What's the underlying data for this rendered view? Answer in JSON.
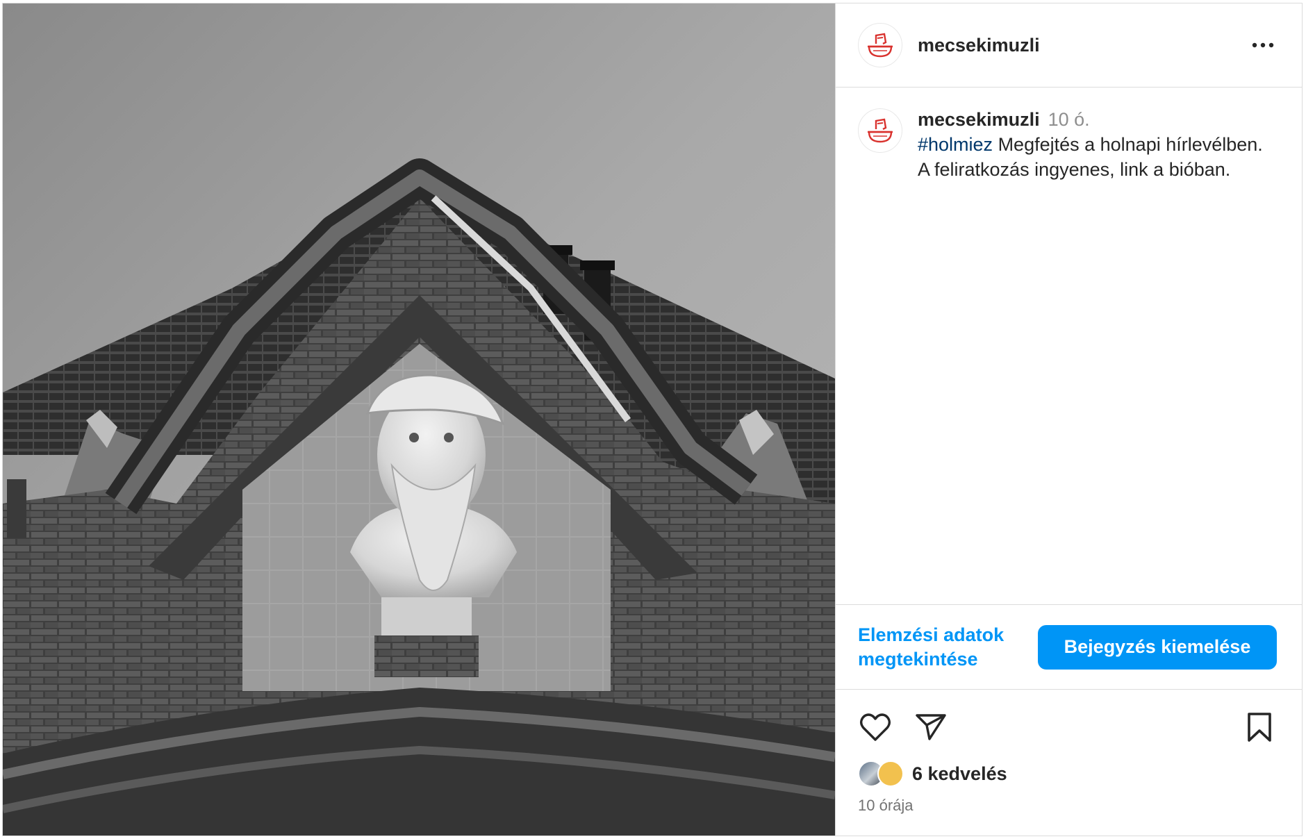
{
  "post": {
    "username": "mecsekimuzli",
    "caption": {
      "username": "mecsekimuzli",
      "time_ago": "10 ó.",
      "hashtag": "#holmiez",
      "text": " Megfejtés a holnapi hírlevélben. A feliratkozás ingyenes, link a bióban."
    },
    "insights_label": "Elemzési adatok megtekintése",
    "boost_label": "Bejegyzés kiemelése",
    "likes_label": "6 kedvelés",
    "timestamp": "10 órája"
  },
  "icons": {
    "avatar": "mug-fist-logo-icon",
    "more": "more-options-icon",
    "like": "heart-icon",
    "share": "paper-plane-icon",
    "save": "bookmark-icon"
  },
  "colors": {
    "link": "#0095f6",
    "hashtag": "#00376b",
    "logo_red": "#d9322e",
    "muted": "#8e8e8e"
  },
  "media": {
    "description_kind": "black-and-white photograph"
  }
}
